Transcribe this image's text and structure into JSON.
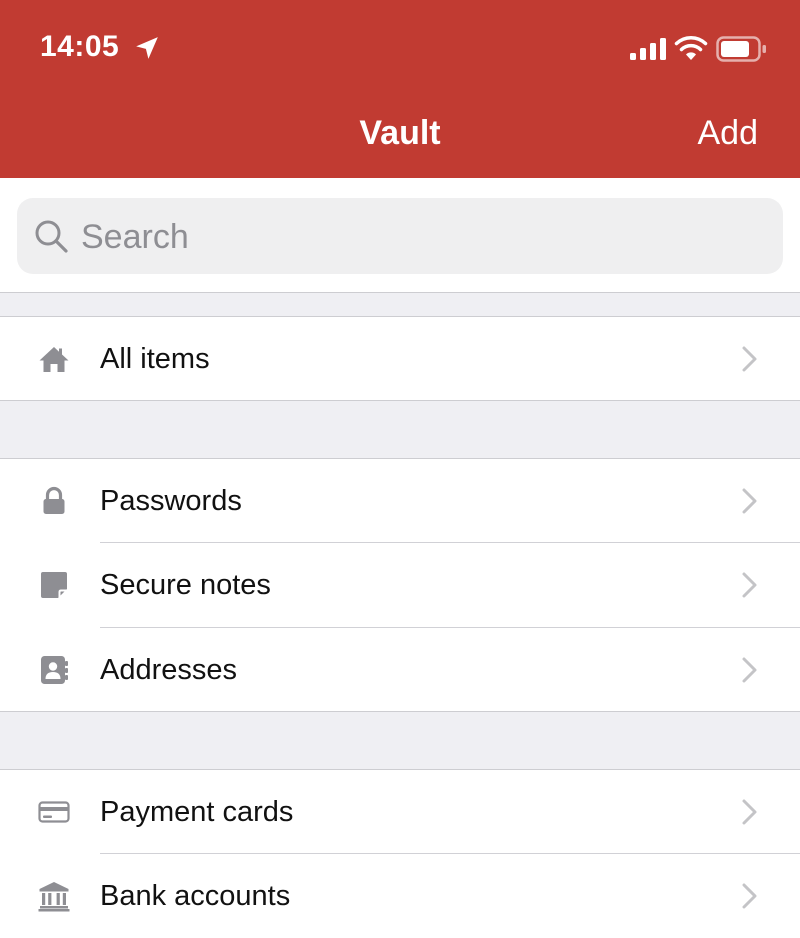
{
  "status_bar": {
    "time": "14:05",
    "icons": [
      "location-arrow-icon",
      "cellular-signal-icon",
      "wifi-icon",
      "battery-icon"
    ]
  },
  "nav": {
    "title": "Vault",
    "add_label": "Add"
  },
  "search": {
    "placeholder": "Search",
    "value": ""
  },
  "colors": {
    "accent": "#c13b32",
    "icon_gray": "#8e8e93",
    "group_background": "#efeff3"
  },
  "sections": [
    {
      "items": [
        {
          "label": "All items",
          "icon": "home-icon"
        }
      ]
    },
    {
      "items": [
        {
          "label": "Passwords",
          "icon": "lock-icon"
        },
        {
          "label": "Secure notes",
          "icon": "note-icon"
        },
        {
          "label": "Addresses",
          "icon": "address-book-icon"
        }
      ]
    },
    {
      "items": [
        {
          "label": "Payment cards",
          "icon": "credit-card-icon"
        },
        {
          "label": "Bank accounts",
          "icon": "bank-icon"
        }
      ]
    }
  ]
}
